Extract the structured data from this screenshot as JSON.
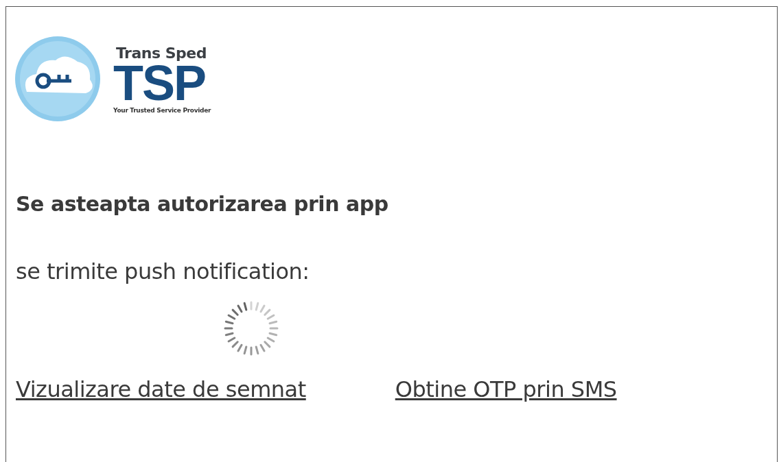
{
  "logo": {
    "name": "Trans Sped",
    "mark": "TSP",
    "tagline": "Your Trusted Service Provider"
  },
  "heading": "Se asteapta autorizarea prin app",
  "status": "se trimite push notification:",
  "links": [
    {
      "label": "Vizualizare date de semnat"
    },
    {
      "label": "Obtine OTP prin SMS"
    }
  ]
}
